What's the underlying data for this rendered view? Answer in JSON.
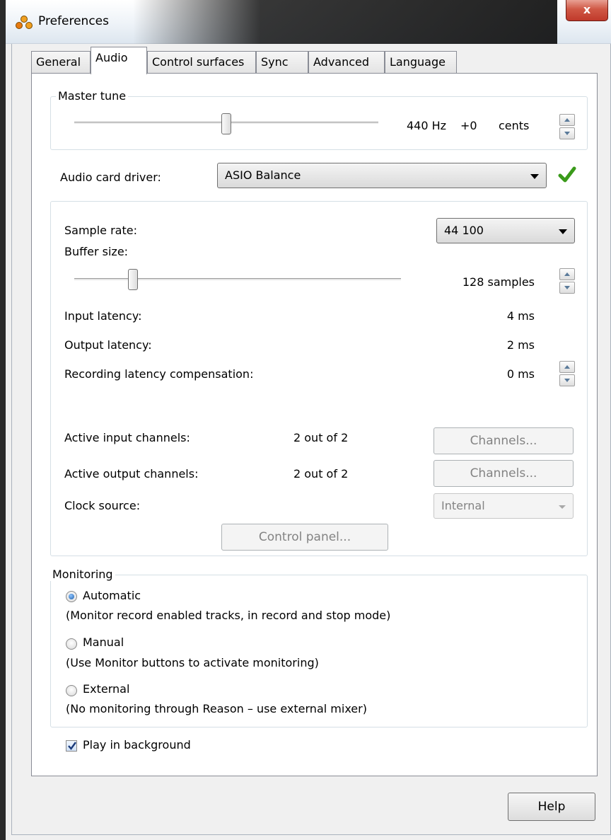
{
  "window": {
    "title": "Preferences",
    "close_glyph": "x"
  },
  "tabs": [
    {
      "label": "General"
    },
    {
      "label": "Audio"
    },
    {
      "label": "Control surfaces"
    },
    {
      "label": "Sync"
    },
    {
      "label": "Advanced"
    },
    {
      "label": "Language"
    }
  ],
  "active_tab": "Audio",
  "master_tune": {
    "group_label": "Master tune",
    "frequency": "440 Hz",
    "offset": "+0",
    "unit": "cents",
    "slider_fraction": 0.5
  },
  "audio_card_driver": {
    "label": "Audio card driver:",
    "value": "ASIO Balance",
    "status_icon": "green-checkmark-icon"
  },
  "driver_settings": {
    "sample_rate_label": "Sample rate:",
    "sample_rate_value": "44 100",
    "buffer_size_label": "Buffer size:",
    "buffer_size_value": "128 samples",
    "buffer_slider_fraction": 0.18,
    "input_latency_label": "Input latency:",
    "input_latency_value": "4 ms",
    "output_latency_label": "Output latency:",
    "output_latency_value": "2 ms",
    "recording_comp_label": "Recording latency compensation:",
    "recording_comp_value": "0 ms",
    "active_input_label": "Active input channels:",
    "active_input_value": "2 out of 2",
    "active_output_label": "Active output channels:",
    "active_output_value": "2 out of 2",
    "channels_button_label": "Channels...",
    "clock_source_label": "Clock source:",
    "clock_source_value": "Internal",
    "control_panel_label": "Control panel..."
  },
  "monitoring": {
    "group_label": "Monitoring",
    "options": [
      {
        "label": "Automatic",
        "description": "(Monitor record enabled tracks, in record and stop mode)",
        "checked": true
      },
      {
        "label": "Manual",
        "description": "(Use Monitor buttons to activate monitoring)",
        "checked": false
      },
      {
        "label": "External",
        "description": "(No monitoring through Reason – use external mixer)",
        "checked": false
      }
    ]
  },
  "play_in_background": {
    "label": "Play in background",
    "checked": true
  },
  "footer": {
    "help_label": "Help"
  },
  "colors": {
    "check_green": "#3a9a1a",
    "radio_blue": "#1c5ea8",
    "close_red": "#c0392b"
  }
}
